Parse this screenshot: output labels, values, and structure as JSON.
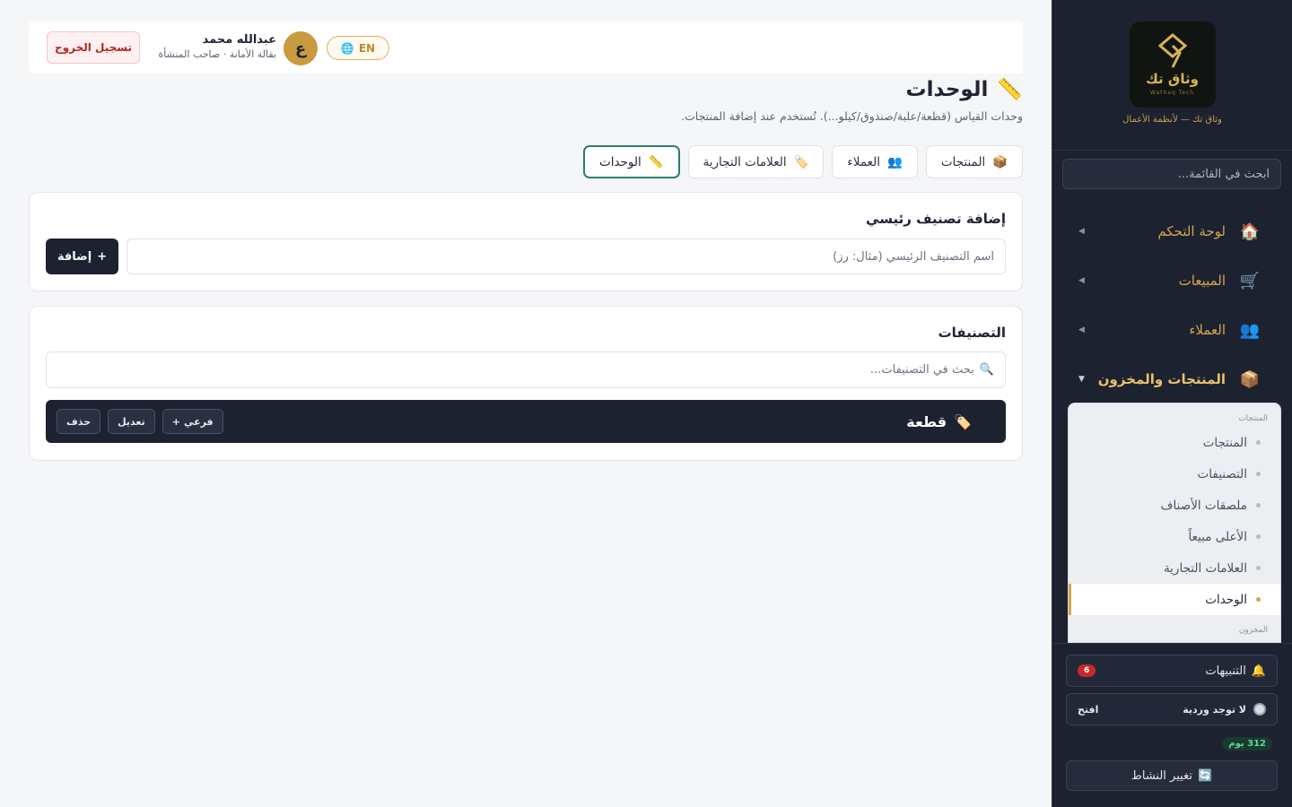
{
  "sidebar": {
    "logo_name": "وثاق تك",
    "logo_sub": "Wathaq Tech",
    "brand_tag": "وثاق تك — لأنظمة الأعمال",
    "search_placeholder": "ابحث في القائمة...",
    "nav": [
      {
        "label": "لوحة التحكم",
        "icon": "🏠",
        "icon_name": "home-icon"
      },
      {
        "label": "المبيعات",
        "icon": "🛒",
        "icon_name": "cart-icon"
      },
      {
        "label": "العملاء",
        "icon": "👥",
        "icon_name": "users-icon"
      },
      {
        "label": "المنتجات والمخزون",
        "icon": "📦",
        "icon_name": "box-icon"
      }
    ],
    "submenu": {
      "group1": "المنتجات",
      "items": [
        "المنتجات",
        "التصنيفات",
        "ملصقات الأصناف",
        "الأعلى مبيعاً",
        "العلامات التجارية",
        "الوحدات"
      ],
      "group2": "المخزون"
    },
    "notifications_label": "التنبيهات",
    "notifications_count": "6",
    "shift_label": "لا توجد وردية",
    "shift_open": "افتح",
    "days": "312 يوم",
    "switch_label": "تغيير النشاط"
  },
  "header": {
    "logout": "تسجيل الخروج",
    "user_name": "عبدالله محمد",
    "user_sub": "بقالة الأمانة · صاحب المنشأة",
    "avatar_letter": "ع",
    "lang": "EN"
  },
  "page": {
    "title": "الوحدات",
    "description": "وحدات القياس (قطعة/علبة/صندوق/كيلو...). تُستخدم عند إضافة المنتجات."
  },
  "tabs": [
    {
      "label": "المنتجات",
      "icon": "📦"
    },
    {
      "label": "العملاء",
      "icon": "👥"
    },
    {
      "label": "العلامات التجارية",
      "icon": "🏷️"
    },
    {
      "label": "الوحدات",
      "icon": "📏"
    }
  ],
  "add_card": {
    "title": "إضافة تصنيف رئيسي",
    "placeholder": "اسم التصنيف الرئيسي (مثال: رز)",
    "button": "إضافة"
  },
  "categories_card": {
    "title": "التصنيفات",
    "search_placeholder": "بحث في التصنيفات...",
    "rows": [
      {
        "name": "قطعة",
        "sub_btn": "فرعي",
        "edit_btn": "تعديل",
        "delete_btn": "حذف"
      }
    ]
  },
  "colors": {
    "sidebar_bg": "#1d2231",
    "accent_gold": "#d4a64b",
    "active_tab_border": "#2e7d6f",
    "danger": "#b3261e"
  }
}
